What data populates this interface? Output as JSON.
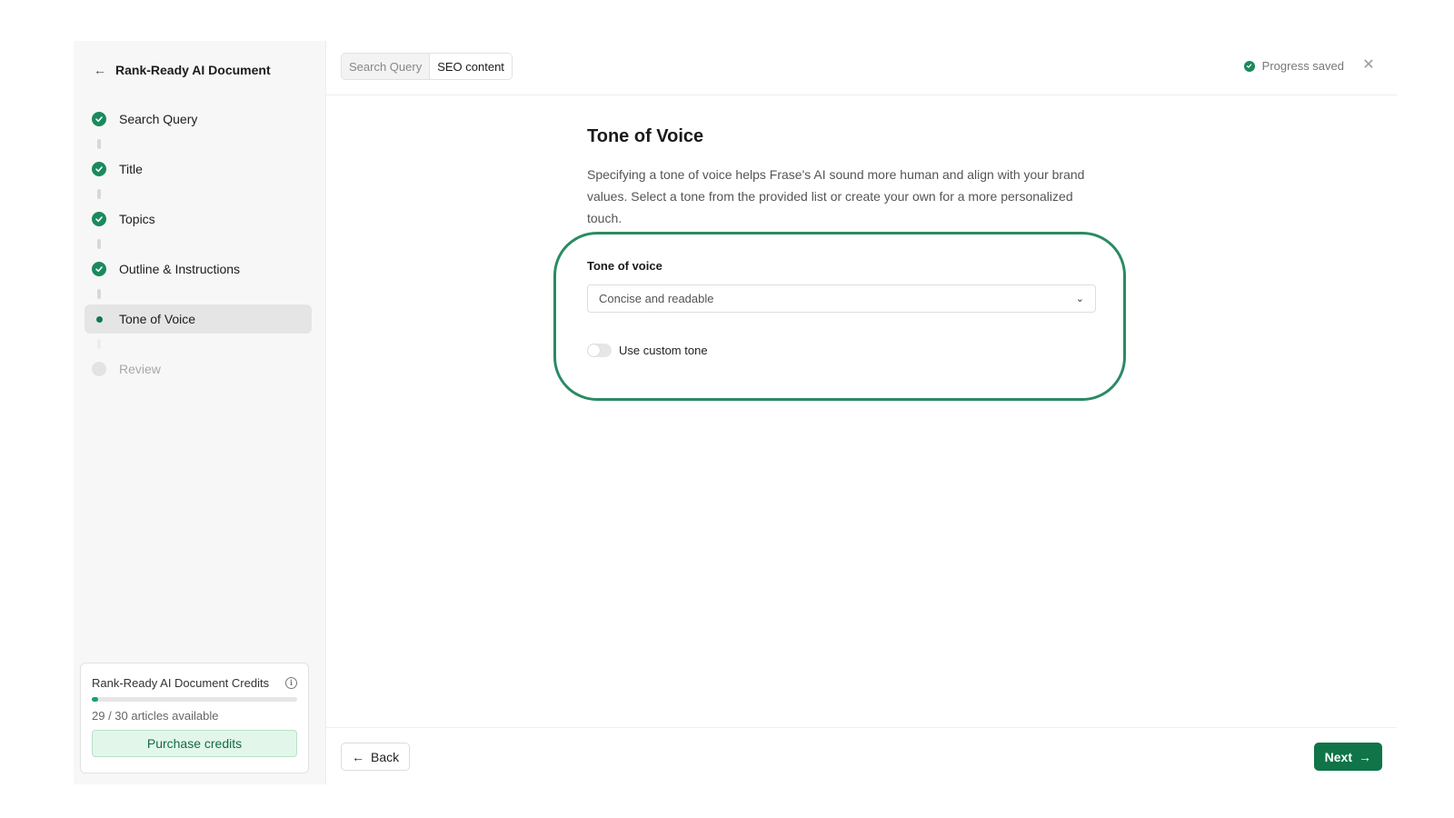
{
  "sidebar": {
    "title": "Rank-Ready AI Document",
    "steps": [
      {
        "label": "Search Query",
        "state": "done"
      },
      {
        "label": "Title",
        "state": "done"
      },
      {
        "label": "Topics",
        "state": "done"
      },
      {
        "label": "Outline & Instructions",
        "state": "done"
      },
      {
        "label": "Tone of Voice",
        "state": "current"
      },
      {
        "label": "Review",
        "state": "todo"
      }
    ],
    "credits": {
      "title": "Rank-Ready AI Document Credits",
      "count_text": "29 / 30 articles available",
      "used_fraction": 0.033,
      "purchase_label": "Purchase credits"
    }
  },
  "topbar": {
    "tabs": [
      {
        "label": "Search Query",
        "active": false
      },
      {
        "label": "SEO content",
        "active": true
      }
    ],
    "status": "Progress saved"
  },
  "content": {
    "heading": "Tone of Voice",
    "description": "Specifying a tone of voice helps Frase's AI sound more human and align with your brand values. Select a tone from the provided list or create your own for a more personalized touch.",
    "field_label": "Tone of voice",
    "selected_tone": "Concise and readable",
    "custom_toggle_label": "Use custom tone",
    "custom_toggle_on": false
  },
  "footer": {
    "back_label": "Back",
    "next_label": "Next"
  },
  "colors": {
    "accent": "#0f7448",
    "highlight_outline": "#2b8a63",
    "done_check": "#1a8a5c"
  }
}
